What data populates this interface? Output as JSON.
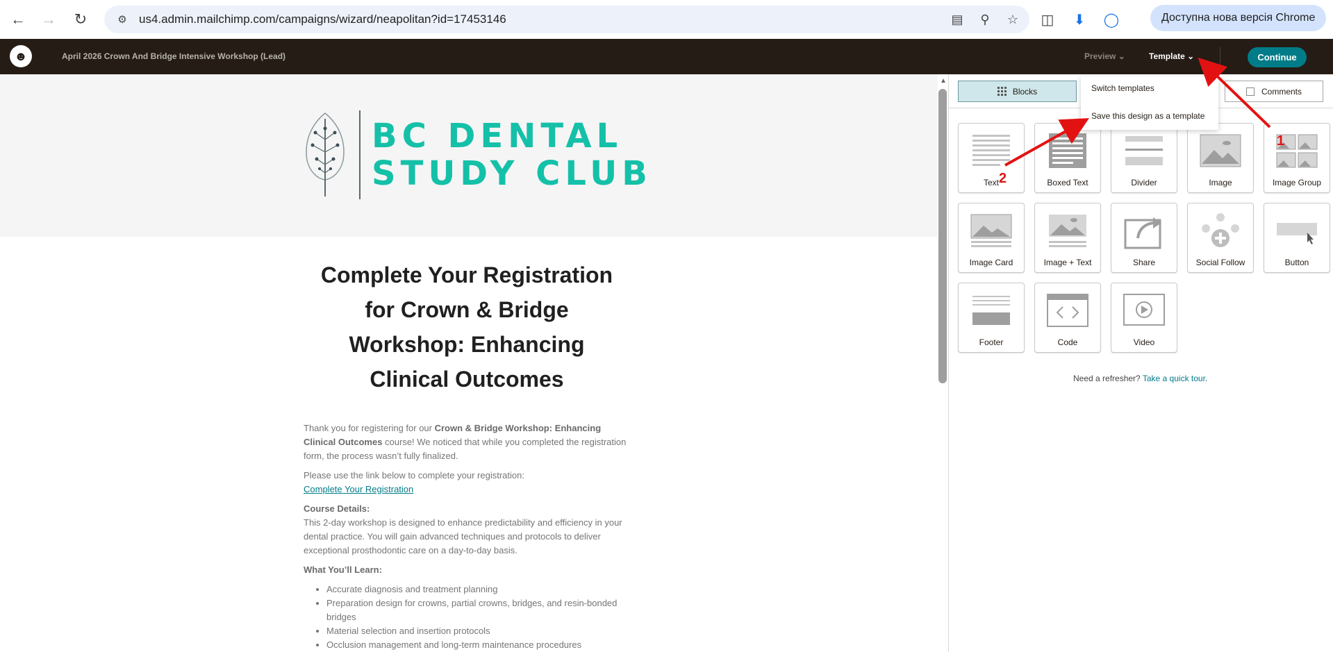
{
  "browser": {
    "url": "us4.admin.mailchimp.com/campaigns/wizard/neapolitan?id=17453146",
    "update_label": "Доступна нова версія Chrome"
  },
  "app": {
    "campaign_title": "April 2026 Crown And Bridge Intensive Workshop (Lead)",
    "preview_label": "Preview",
    "template_label": "Template",
    "continue_label": "Continue"
  },
  "dropdown": {
    "items": [
      "Switch templates",
      "Save this design as a template"
    ]
  },
  "panel": {
    "tabs": [
      "Blocks",
      "Comments"
    ],
    "blocks": [
      "Text",
      "Boxed Text",
      "Divider",
      "Image",
      "Image Group",
      "Image Card",
      "Image + Text",
      "Share",
      "Social Follow",
      "Button",
      "Footer",
      "Code",
      "Video"
    ],
    "refresher_text": "Need a refresher?",
    "refresher_link": "Take a quick tour"
  },
  "email": {
    "logo_line1": "BC DENTAL",
    "logo_line2": "STUDY CLUB",
    "title_line1": "Complete Your Registration",
    "title_line2": "for Crown & Bridge",
    "title_line3": "Workshop: Enhancing",
    "title_line4": "Clinical Outcomes",
    "intro_before": "Thank you for registering for our ",
    "intro_bold": "Crown & Bridge Workshop: Enhancing Clinical Outcomes",
    "intro_after": " course! We noticed that while you completed the registration form, the process wasn’t fully finalized.",
    "link_intro": "Please use the link below to complete your registration:",
    "link_text": "Complete Your Registration",
    "details_heading": "Course Details:",
    "details_text": "This 2-day workshop is designed to enhance predictability and efficiency in your dental practice. You will gain advanced techniques and protocols to deliver exceptional prosthodontic care on a day-to-day basis.",
    "learn_heading": "What You’ll Learn:",
    "learn_items": [
      "Accurate diagnosis and treatment planning",
      "Preparation design for crowns, partial crowns, bridges, and resin-bonded bridges",
      "Material selection and insertion protocols",
      "Occlusion management and long-term maintenance procedures"
    ]
  },
  "annotations": {
    "label1": "1",
    "label2": "2",
    "color": "#e31212"
  },
  "colors": {
    "mc_bar": "#241c15",
    "accent": "#007c89",
    "logo_teal": "#14c0a8"
  }
}
